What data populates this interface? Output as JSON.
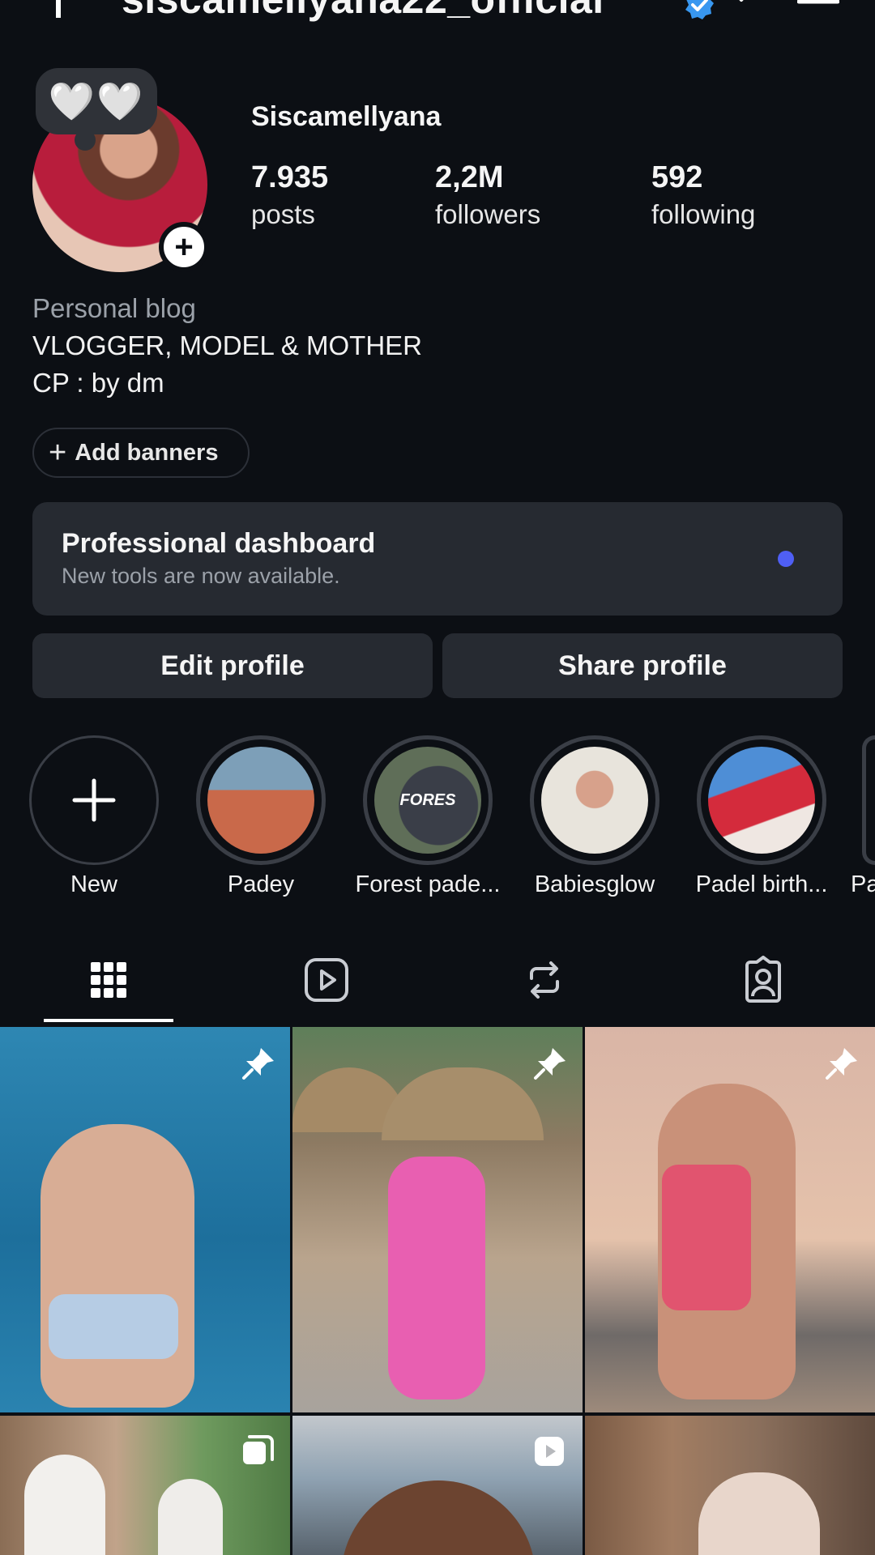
{
  "header": {
    "username": "siscamellyana22_official",
    "icons": [
      "plus-icon",
      "verified-badge-icon",
      "chevron-down-icon",
      "menu-icon"
    ]
  },
  "profile": {
    "note_emoji": "🤍🤍",
    "display_name": "Siscamellyana",
    "stats": [
      {
        "value": "7.935",
        "label": "posts"
      },
      {
        "value": "2,2M",
        "label": "followers"
      },
      {
        "value": "592",
        "label": "following"
      }
    ],
    "bio": {
      "category": "Personal blog",
      "lines": [
        "VLOGGER, MODEL & MOTHER",
        "CP : by dm"
      ]
    }
  },
  "add_banners": {
    "plus": "+",
    "label": "Add banners"
  },
  "dashboard": {
    "title": "Professional dashboard",
    "subtitle": "New tools are now available.",
    "dot_color": "#4f5ff5"
  },
  "buttons": {
    "edit": "Edit profile",
    "share": "Share profile"
  },
  "highlights": [
    {
      "label": "New"
    },
    {
      "label": "Padey"
    },
    {
      "label": "Forest pade..."
    },
    {
      "label": "Babiesglow"
    },
    {
      "label": "Padel birth..."
    },
    {
      "label": "Pa"
    }
  ],
  "highlight_badge_text": "FORES",
  "tabs": [
    "grid-icon",
    "reels-icon",
    "reposts-icon",
    "tagged-icon"
  ],
  "colors": {
    "background": "#0c0f14",
    "card": "#262a31",
    "verified": "#3897f0"
  }
}
